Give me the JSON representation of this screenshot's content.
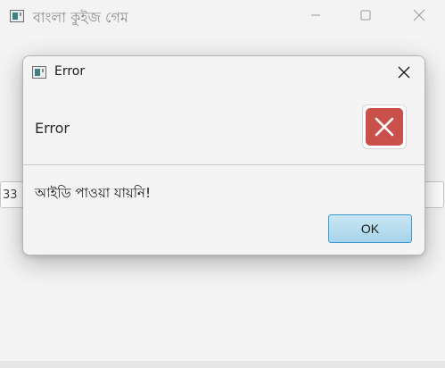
{
  "main_window": {
    "title": "বাংলা কুইজ গেম",
    "background_input_value": "33"
  },
  "dialog": {
    "title": "Error",
    "header_text": "Error",
    "message": "আইডি পাওয়া যায়নি!",
    "ok_label": "OK"
  },
  "colors": {
    "error_icon": "#c9504b",
    "ok_button_border": "#3b9bd0",
    "ok_button_fill": "#b8dcef"
  },
  "icons": {
    "app": "app-window-icon",
    "minimize": "minimize-icon",
    "maximize": "maximize-icon",
    "close": "close-icon",
    "error": "error-x-icon"
  }
}
